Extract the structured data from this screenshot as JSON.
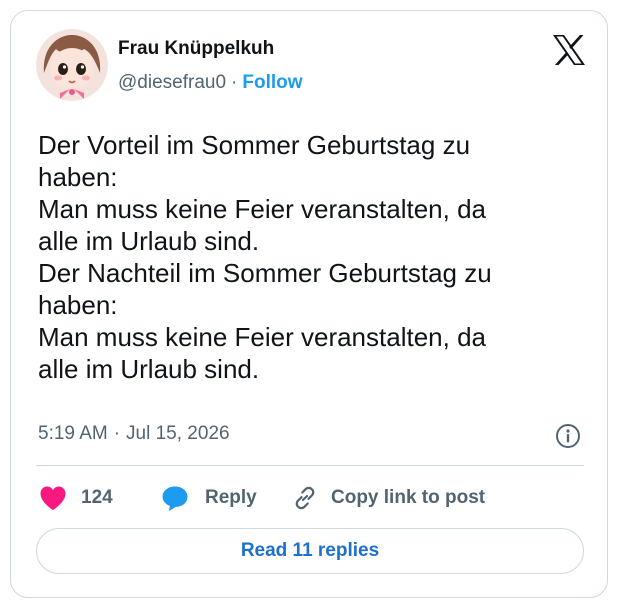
{
  "author": {
    "name": "Frau Knüppelkuh",
    "handle": "@diesefrau0",
    "separator": "·",
    "follow_label": "Follow",
    "avatar_icon": "doll-avatar-icon"
  },
  "tweet": {
    "lines": [
      "Der Vorteil im Sommer Geburtstag zu",
      "haben:",
      "Man muss keine Feier veranstalten, da",
      "alle im Urlaub sind.",
      "Der Nachteil im Sommer Geburtstag zu",
      "haben:",
      "Man muss keine Feier veranstalten, da",
      "alle im Urlaub sind."
    ],
    "time": "5:19 AM",
    "date_separator": "·",
    "date": "Jul 15, 2026"
  },
  "actions": {
    "like_count": "124",
    "reply_label": "Reply",
    "copy_link_label": "Copy link to post"
  },
  "footer": {
    "read_replies_label": "Read 11 replies"
  },
  "icons": {
    "logo": "x-logo-icon",
    "info": "info-icon",
    "like": "heart-icon",
    "reply": "speech-bubble-icon",
    "copy": "link-icon"
  },
  "colors": {
    "accent": "#1d9bf0",
    "like": "#f91880",
    "muted": "#536471",
    "border": "#cfd9de",
    "reply_blue": "#1d6fd0"
  }
}
